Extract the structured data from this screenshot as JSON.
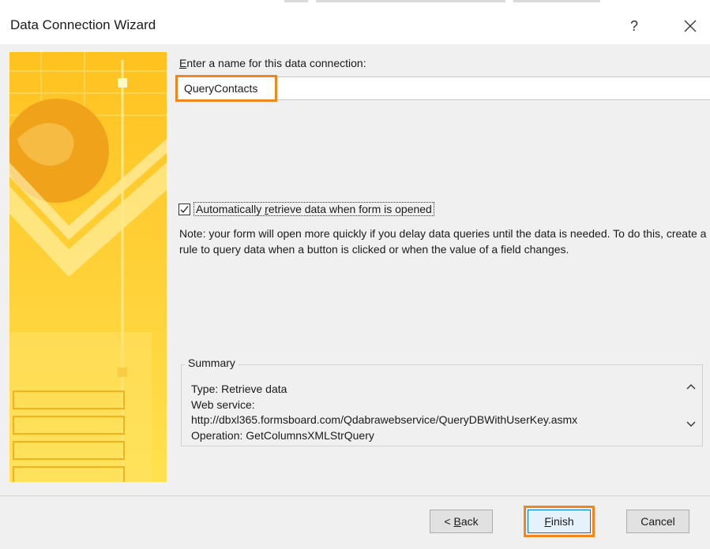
{
  "window": {
    "title": "Data Connection Wizard",
    "help_label": "?",
    "close_label": "✕"
  },
  "name_field": {
    "label_accel": "E",
    "label_rest": "nter a name for this data connection:",
    "value": "QueryContacts"
  },
  "auto_retrieve": {
    "checked": true,
    "label_pre": "Automatically ",
    "label_accel": "r",
    "label_post": "etrieve data when form is opened"
  },
  "note": "Note: your form will open more quickly if you delay data queries until the data is needed. To do this, create a rule to query data when a button is clicked or when the value of a field changes.",
  "summary": {
    "legend": "Summary",
    "lines": [
      "Type: Retrieve data",
      "Web service:",
      "http://dbxl365.formsboard.com/Qdabrawebservice/QueryDBWithUserKey.asmx",
      "Operation: GetColumnsXMLStrQuery"
    ]
  },
  "buttons": {
    "back_pre": "< ",
    "back_accel": "B",
    "back_post": "ack",
    "finish_accel": "F",
    "finish_post": "inish",
    "cancel": "Cancel"
  },
  "colors": {
    "highlight": "#f0861e",
    "art_yellow": "#ffc21f",
    "dialog_bg": "#f0f0f0"
  }
}
